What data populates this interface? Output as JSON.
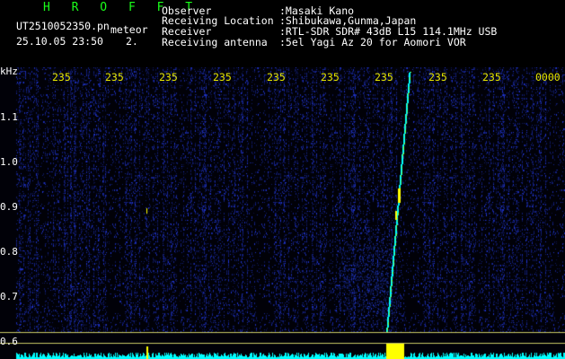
{
  "header": {
    "logo": "H R O F F T",
    "filename": "UT2510052350.pn",
    "tag": "meteor",
    "datetime": "25.10.05 23:50",
    "count": "2."
  },
  "info": [
    {
      "label": "Observer",
      "value": ":Masaki Kano"
    },
    {
      "label": "Receiving Location",
      "value": ":Shibukawa,Gunma,Japan"
    },
    {
      "label": "Receiver",
      "value": ":RTL-SDR SDR# 43dB L15 114.1MHz USB"
    },
    {
      "label": "Receiving antenna",
      "value": ":5el Yagi Az 20 for Aomori VOR"
    }
  ],
  "spectrogram": {
    "yunit": "kHz",
    "yticks": [
      "1.1",
      "1.0",
      "0.9",
      "0.8",
      "0.7",
      "0.6"
    ],
    "time_labels": [
      "235",
      "235",
      "235",
      "235",
      "235",
      "235",
      "235",
      "235",
      "235",
      "0000"
    ],
    "colors": {
      "background": "#010108",
      "noise": "#1a2ab8",
      "signal": "#00ffff",
      "peak": "#ffff00",
      "baseline": "#c8c864"
    }
  }
}
